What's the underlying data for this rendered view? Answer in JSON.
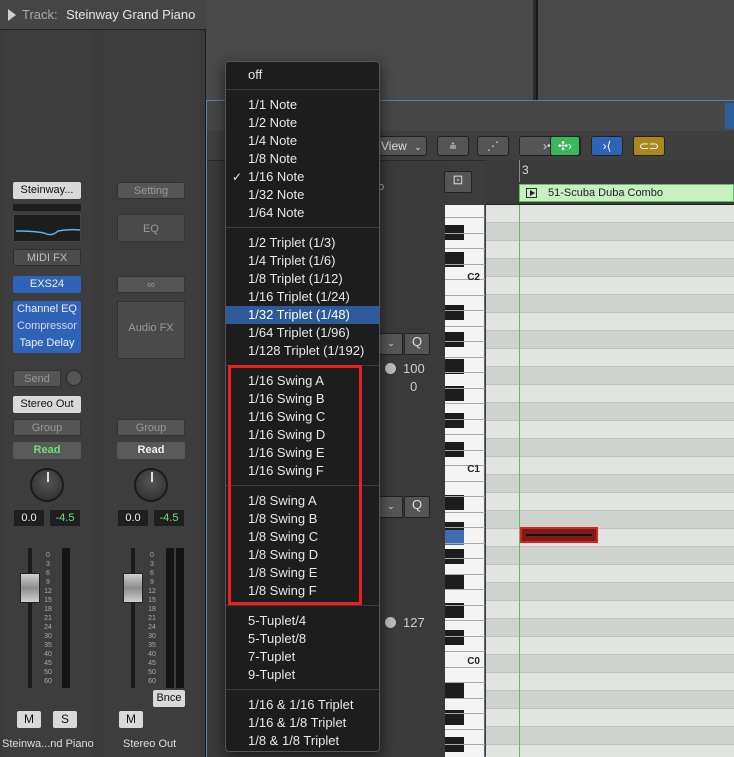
{
  "inspector": {
    "track_label": "Track:",
    "track_name": "Steinway Grand Piano",
    "strip1": {
      "setting_label": "Steinway...",
      "midi_fx_label": "MIDI FX",
      "instrument_label": "EXS24",
      "effects": [
        "Channel EQ",
        "Compressor",
        "Tape Delay"
      ],
      "send_label": "Send",
      "output_label": "Stereo Out",
      "group_label": "Group",
      "automation_label": "Read",
      "volume_value": "0.0",
      "pan_value": "-4.5",
      "mute_label": "M",
      "solo_label": "S",
      "name": "Steinwa...nd Piano"
    },
    "strip2": {
      "setting_label": "Setting",
      "eq_label": "EQ",
      "audio_fx_label": "Audio FX",
      "group_label": "Group",
      "automation_label": "Read",
      "volume_value": "0.0",
      "pan_value": "-4.5",
      "bounce_label": "Bnce",
      "mute_label": "M",
      "name": "Stereo Out"
    },
    "scale_ticks": [
      "0",
      "3",
      "6",
      "9",
      "12",
      "15",
      "18",
      "21",
      "24",
      "30",
      "35",
      "40",
      "45",
      "50",
      "60"
    ]
  },
  "editor": {
    "view_label": "View",
    "ruler_bar": "3",
    "region_name": "51-Scuba Duba  Combo",
    "obscured_label": "bo",
    "q_label": "Q",
    "strength_value": "100",
    "swing_value": "0",
    "velocity_value": "127",
    "key_labels": [
      "C2",
      "C1",
      "C0"
    ]
  },
  "menu": {
    "groups": [
      [
        {
          "label": "off"
        }
      ],
      [
        {
          "label": "1/1 Note"
        },
        {
          "label": "1/2 Note"
        },
        {
          "label": "1/4 Note"
        },
        {
          "label": "1/8 Note"
        },
        {
          "label": "1/16 Note",
          "checked": true
        },
        {
          "label": "1/32 Note"
        },
        {
          "label": "1/64 Note"
        }
      ],
      [
        {
          "label": "1/2 Triplet (1/3)"
        },
        {
          "label": "1/4 Triplet (1/6)"
        },
        {
          "label": "1/8 Triplet (1/12)"
        },
        {
          "label": "1/16 Triplet (1/24)"
        },
        {
          "label": "1/32 Triplet (1/48)",
          "highlighted": true
        },
        {
          "label": "1/64 Triplet (1/96)"
        },
        {
          "label": "1/128 Triplet (1/192)"
        }
      ],
      [
        {
          "label": "1/16 Swing A"
        },
        {
          "label": "1/16 Swing B"
        },
        {
          "label": "1/16 Swing C"
        },
        {
          "label": "1/16 Swing D"
        },
        {
          "label": "1/16 Swing E"
        },
        {
          "label": "1/16 Swing F"
        }
      ],
      [
        {
          "label": "1/8 Swing A"
        },
        {
          "label": "1/8 Swing B"
        },
        {
          "label": "1/8 Swing C"
        },
        {
          "label": "1/8 Swing D"
        },
        {
          "label": "1/8 Swing E"
        },
        {
          "label": "1/8 Swing F"
        }
      ],
      [
        {
          "label": "5-Tuplet/4"
        },
        {
          "label": "5-Tuplet/8"
        },
        {
          "label": "7-Tuplet"
        },
        {
          "label": "9-Tuplet"
        }
      ],
      [
        {
          "label": "1/16 & 1/16 Triplet"
        },
        {
          "label": "1/16 & 1/8 Triplet"
        },
        {
          "label": "1/8 & 1/8 Triplet"
        }
      ]
    ]
  },
  "colors": {
    "highlight": "#2d5a9a",
    "annotation_red": "#e8201f",
    "region_green": "#c7f0c0",
    "read_green": "#6fe07a"
  }
}
